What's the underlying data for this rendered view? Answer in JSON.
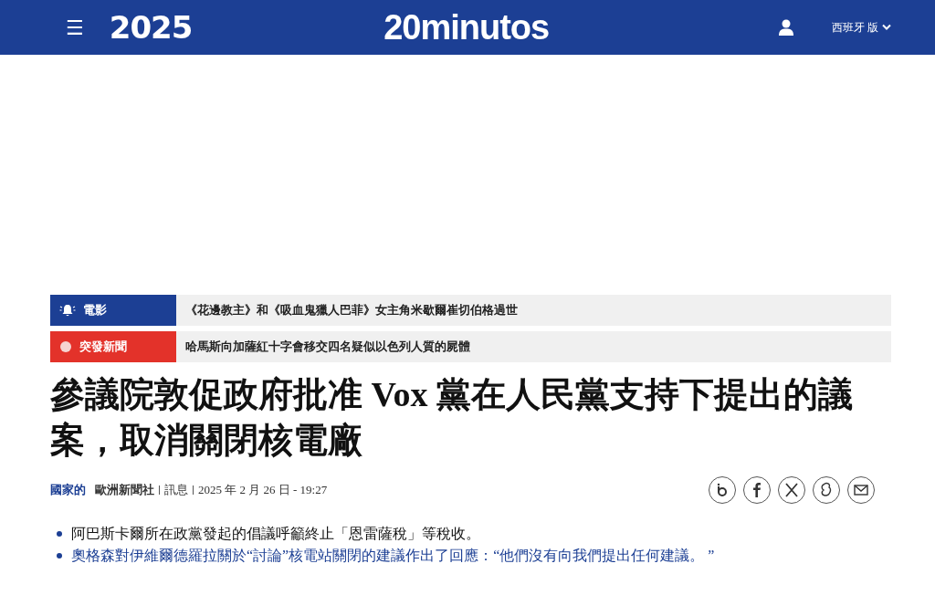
{
  "header": {
    "menu_icon": "☰",
    "logo_year": "2025",
    "logo": "20minutos",
    "edition": "西班牙 版"
  },
  "tickers": [
    {
      "kind": "alert",
      "label": "電影",
      "color": "#1c3f94",
      "text": "《花邊教主》和《吸血鬼獵人巴菲》女主角米歇爾崔切伯格過世"
    },
    {
      "kind": "breaking",
      "label": "突發新聞",
      "color": "#e3322a",
      "text": "哈馬斯向加薩紅十字會移交四名疑似以色列人質的屍體"
    }
  ],
  "headline": "參議院敦促政府批准 Vox 黨在人民黨支持下提出的議案，取消關閉核電廠",
  "byline": {
    "section": "國家的",
    "author": "歐洲新聞社",
    "type": "訊息",
    "date": "2025 年 2 月 26 日 - 19:27"
  },
  "share": [
    {
      "kind": "share"
    },
    {
      "kind": "facebook"
    },
    {
      "kind": "x"
    },
    {
      "kind": "other"
    },
    {
      "kind": "email"
    }
  ],
  "bullets": [
    {
      "kind": "text",
      "text": "阿巴斯卡爾所在政黨發起的倡議呼籲終止「恩雷薩稅」等稅收。"
    },
    {
      "kind": "link",
      "text": "奧格森對伊維爾德羅拉關於“討論”核電站關閉的建議作出了回應：“他們沒有向我們提出任何建議。 ”"
    }
  ]
}
